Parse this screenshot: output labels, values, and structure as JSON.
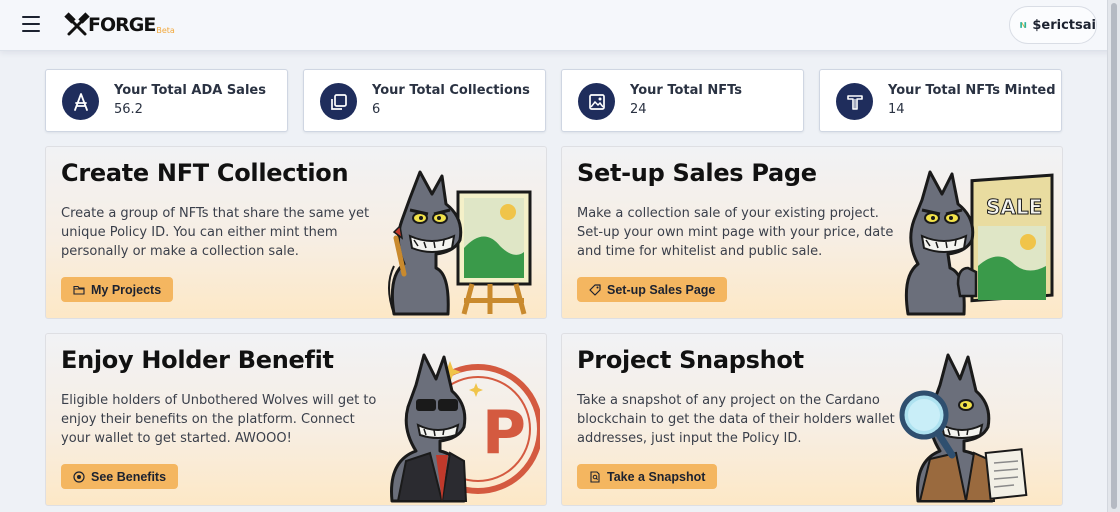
{
  "header": {
    "brand": "FORGE",
    "beta_label": "Beta",
    "account_name": "$erictsai"
  },
  "stats": [
    {
      "label": "Your Total ADA Sales",
      "value": "56.2",
      "icon": "ada-icon"
    },
    {
      "label": "Your Total Collections",
      "value": "6",
      "icon": "collections-icon"
    },
    {
      "label": "Your Total NFTs",
      "value": "24",
      "icon": "image-icon"
    },
    {
      "label": "Your Total NFTs Minted",
      "value": "14",
      "icon": "mint-icon"
    }
  ],
  "cards": [
    {
      "title": "Create NFT Collection",
      "description": "Create a group of NFTs that share the same yet unique Policy ID. You can either mint them personally or make a collection sale.",
      "button": "My Projects",
      "button_icon": "folder-icon",
      "art": "wolf-painter-illustration"
    },
    {
      "title": "Set-up Sales Page",
      "description": "Make a collection sale of your existing project. Set-up your own mint page with your price, date and time for whitelist and public sale.",
      "button": "Set-up Sales Page",
      "button_icon": "tag-icon",
      "art": "wolf-sale-sign-illustration",
      "art_text": "SALE"
    },
    {
      "title": "Enjoy Holder Benefit",
      "description": "Eligible holders of Unbothered Wolves will get to enjoy their benefits on the platform. Connect your wallet to get started. AWOOO!",
      "button": "See Benefits",
      "button_icon": "target-icon",
      "art": "wolf-sunglasses-illustration"
    },
    {
      "title": "Project Snapshot",
      "description": "Take a snapshot of any project on the Cardano blockchain to get the data of their holders wallet addresses, just input the Policy ID.",
      "button": "Take a Snapshot",
      "button_icon": "document-search-icon",
      "art": "wolf-magnifier-illustration"
    }
  ],
  "colors": {
    "accent": "#f4b660",
    "icon_bg": "#1f2d5c",
    "beta": "#f2a83c"
  }
}
